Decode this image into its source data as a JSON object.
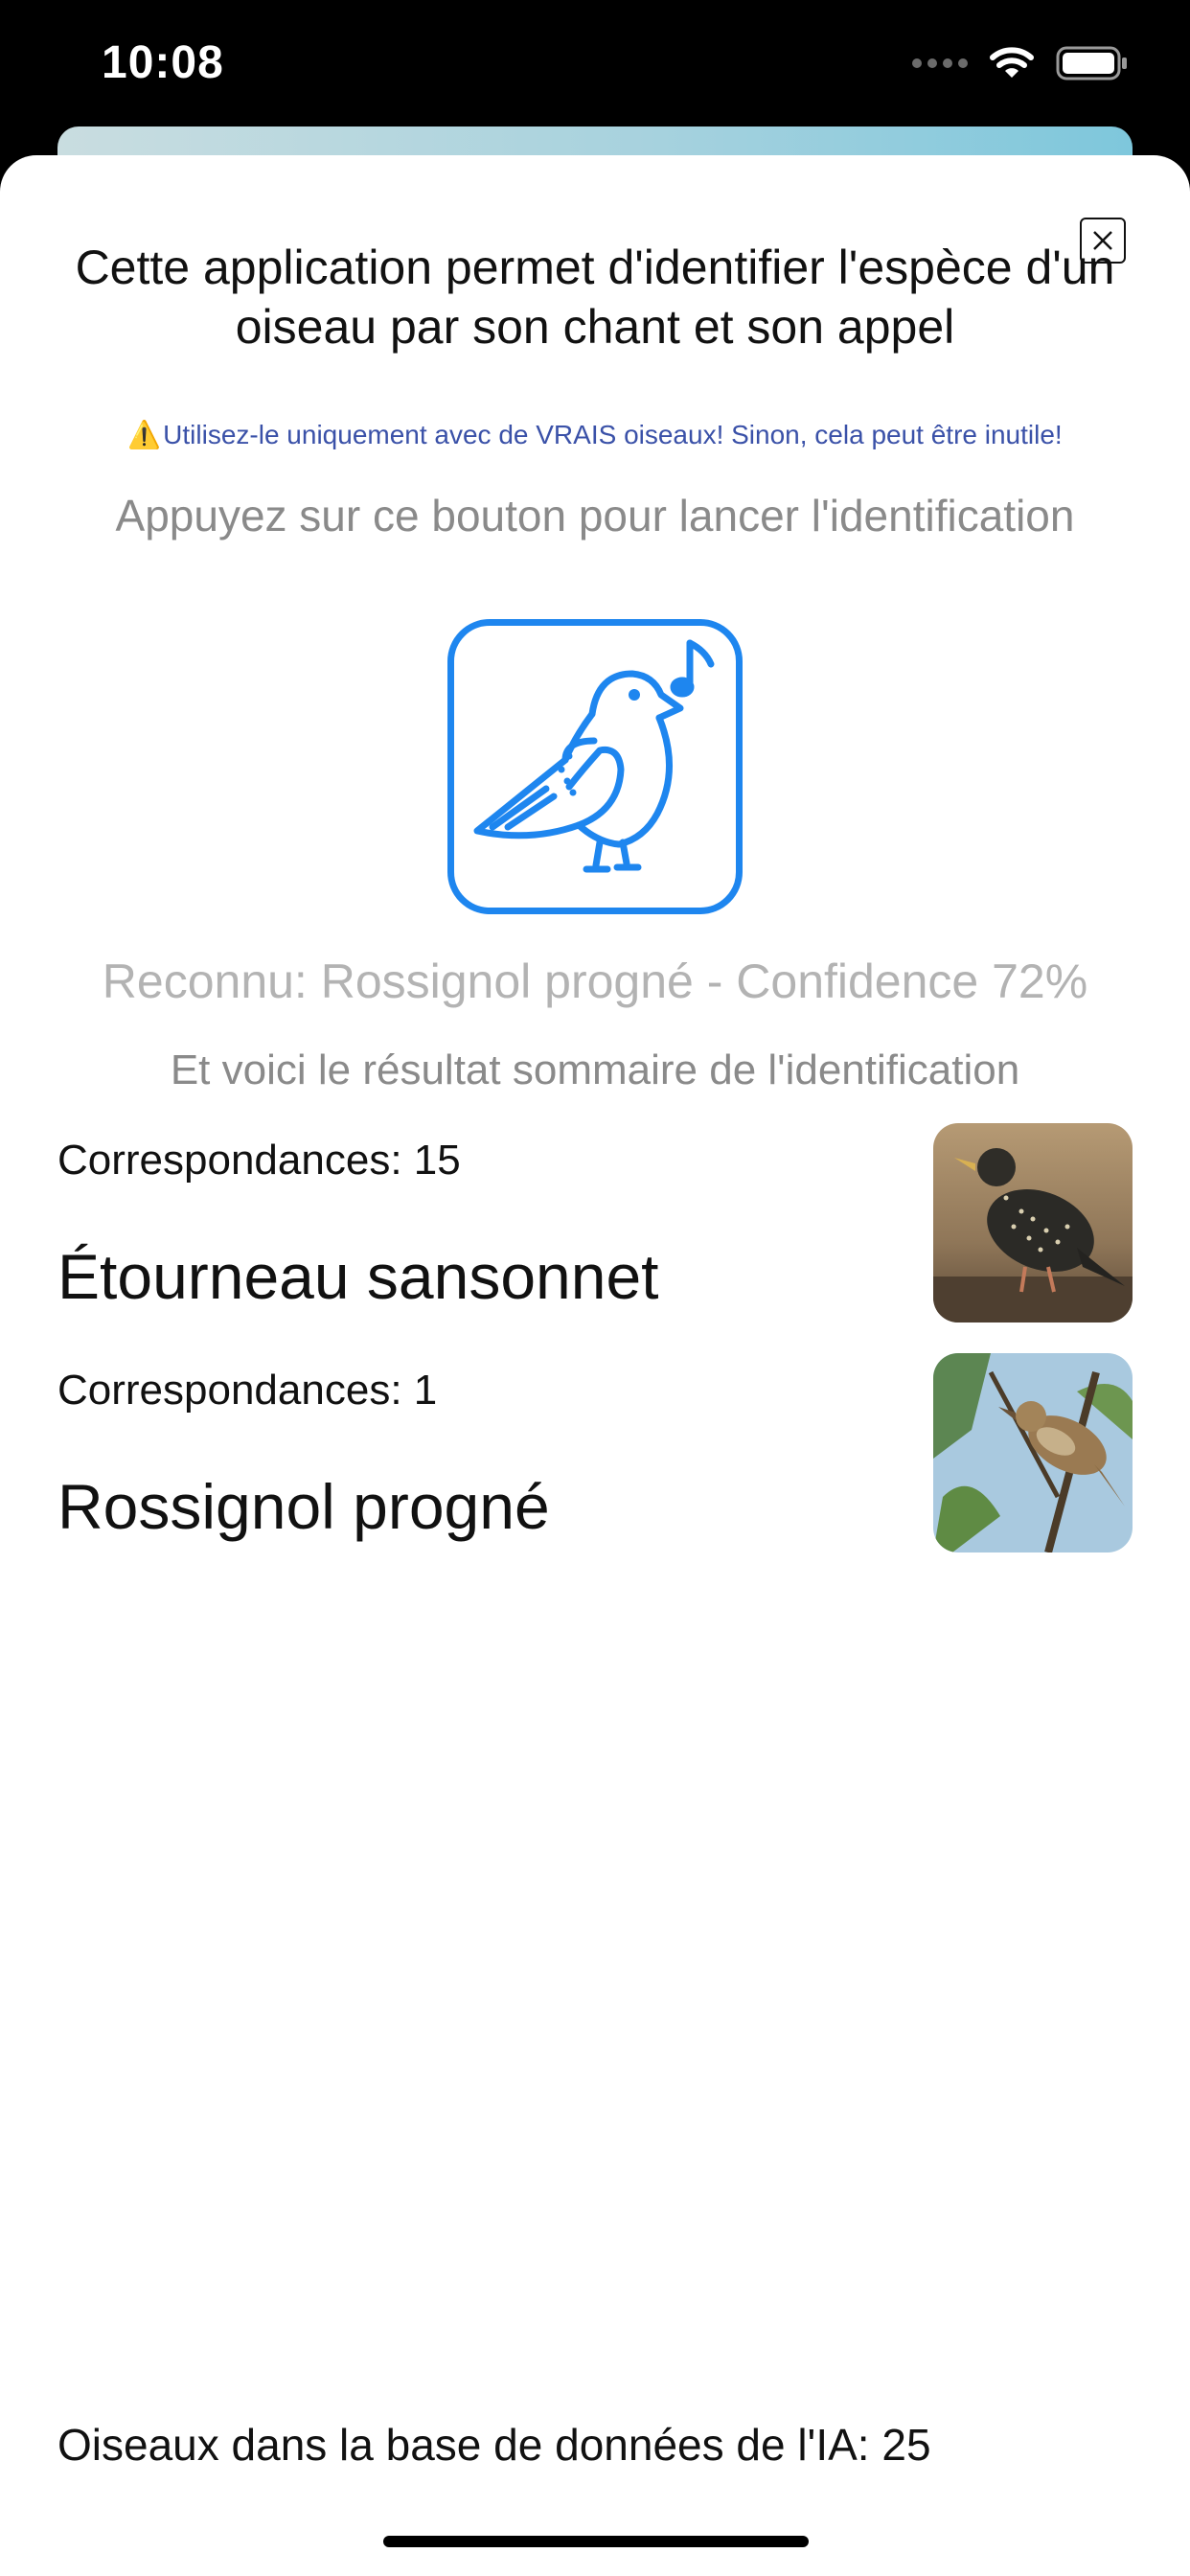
{
  "status_bar": {
    "time": "10:08",
    "icons": [
      "signal-icon",
      "wifi-icon",
      "battery-icon"
    ]
  },
  "modal": {
    "close_icon": "close-icon",
    "intro": "Cette application permet d'identifier l'espèce d'un oiseau par son chant et son appel",
    "warning_icon": "⚠️",
    "warning": "Utilisez-le uniquement avec de VRAIS oiseaux! Sinon, cela peut être inutile!",
    "prompt": "Appuyez sur ce bouton pour lancer l'identification",
    "identify_button_icon": "singing-bird-icon",
    "recognized": "Reconnu: Rossignol progné - Confidence 72%",
    "summary_heading": "Et voici le résultat sommaire de l'identification",
    "results": [
      {
        "matches": "Correspondances: 15",
        "species": "Étourneau sansonnet",
        "photo": "starling-photo"
      },
      {
        "matches": "Correspondances: 1",
        "species": "Rossignol progné",
        "photo": "nightingale-photo"
      }
    ],
    "footer": "Oiseaux dans la base de données de l'IA: 25"
  },
  "colors": {
    "accent": "#1e86ef",
    "warning_text": "#3a51a8",
    "muted_text": "#8a8a8a",
    "faded_text": "#b3b3b3"
  }
}
